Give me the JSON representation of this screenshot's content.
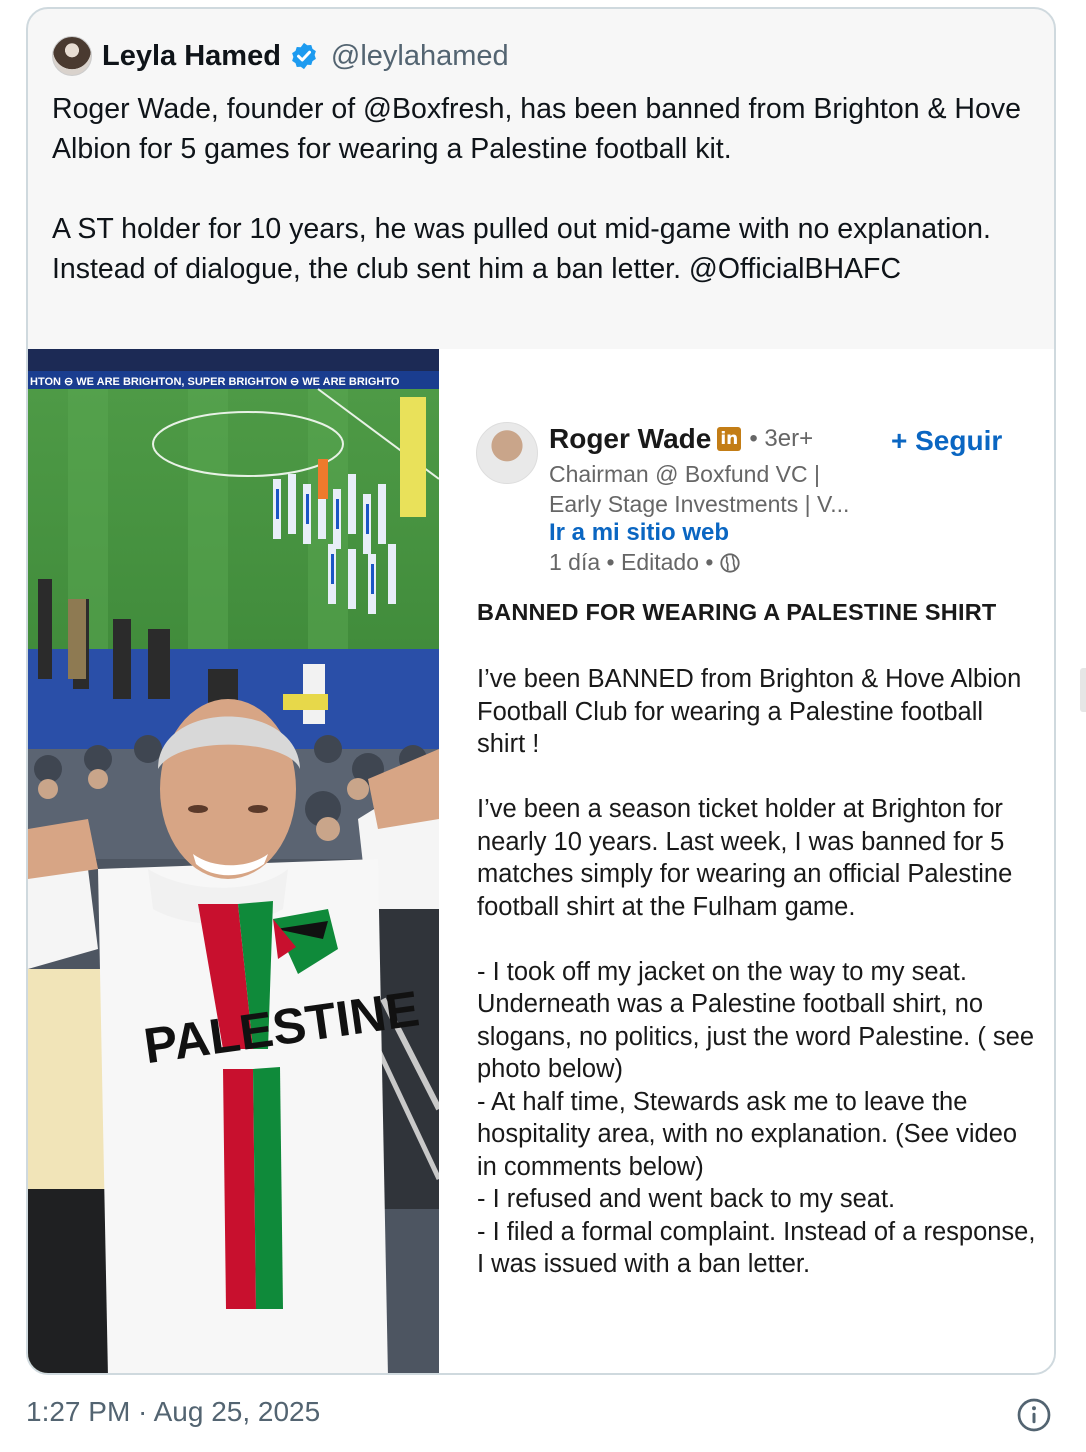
{
  "tweet": {
    "author_name": "Leyla Hamed",
    "author_handle": "@leylahamed",
    "text": "Roger Wade, founder of @Boxfresh, has been banned from Brighton & Hove Albion for 5 games for wearing a Palestine football kit.\n\nA ST holder for 10 years, he was pulled out mid-game with no explanation. Instead of dialogue, the club sent him a ban letter. @OfficialBHAFC",
    "timestamp": "1:27 PM · Aug 25, 2025"
  },
  "photo": {
    "banner_text": "HTON ⊖ WE ARE BRIGHTON, SUPER BRIGHTON ⊖ WE ARE BRIGHTO",
    "shirt_text": "PALESTINE"
  },
  "linkedin": {
    "name": "Roger Wade",
    "badge": "in",
    "degree": "• 3er+",
    "follow_label": "+ Seguir",
    "headline_line1": "Chairman @ Boxfund VC |",
    "headline_line2": "Early Stage Investments | V...",
    "website_link": "Ir a mi sitio web",
    "time": "1 día • Editado •",
    "post_title": "BANNED FOR WEARING A PALESTINE SHIRT",
    "post_body": "I’ve been BANNED from Brighton & Hove Albion Football Club for wearing a Palestine football shirt !\n\nI’ve been a season ticket holder at Brighton for nearly 10 years. Last week, I was banned for 5 matches simply for wearing an official Palestine football shirt at the Fulham game.\n\n- I took off my jacket on the way to my seat. Underneath was a Palestine football shirt, no slogans, no politics, just the word Palestine. ( see photo below)\n- At half time, Stewards ask me to leave the hospitality area, with no explanation. (See video in comments below)\n- I refused and went back to my seat.\n- I filed a formal complaint. Instead of a response, I was issued with a ban letter."
  },
  "colors": {
    "verified_blue": "#1d9bf0",
    "linkedin_blue": "#0a66c2",
    "muted_text": "#536471"
  },
  "icons": [
    "verified-badge-icon",
    "linkedin-badge-icon",
    "globe-icon",
    "info-icon"
  ]
}
